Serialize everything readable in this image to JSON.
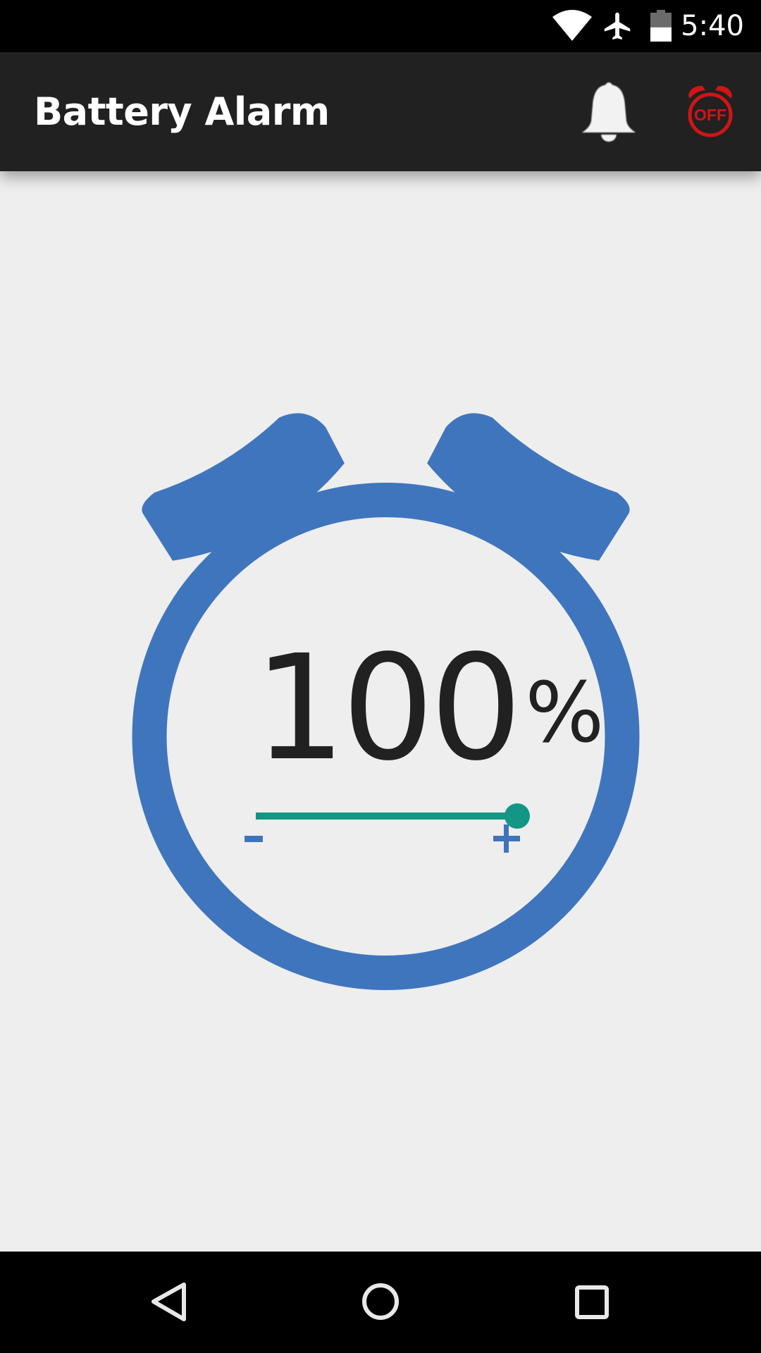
{
  "status_bar": {
    "time": "5:40",
    "icons": [
      "wifi-icon",
      "airplane-mode-icon",
      "battery-icon"
    ],
    "battery_level_percent": 50
  },
  "app_bar": {
    "title": "Battery Alarm",
    "actions": [
      {
        "name": "notification-bell",
        "icon": "bell-icon"
      },
      {
        "name": "alarm-off-toggle",
        "icon": "alarm-clock-off-icon",
        "label": "OFF",
        "color": "#d01515"
      }
    ]
  },
  "alarm": {
    "threshold_value": "100",
    "unit": "%",
    "slider": {
      "min_label": "-",
      "max_label": "+",
      "value_percent": 100,
      "fill_color": "#139684"
    },
    "clock_color": "#3f75bd"
  },
  "nav_bar": {
    "buttons": [
      "back",
      "home",
      "recents"
    ]
  }
}
